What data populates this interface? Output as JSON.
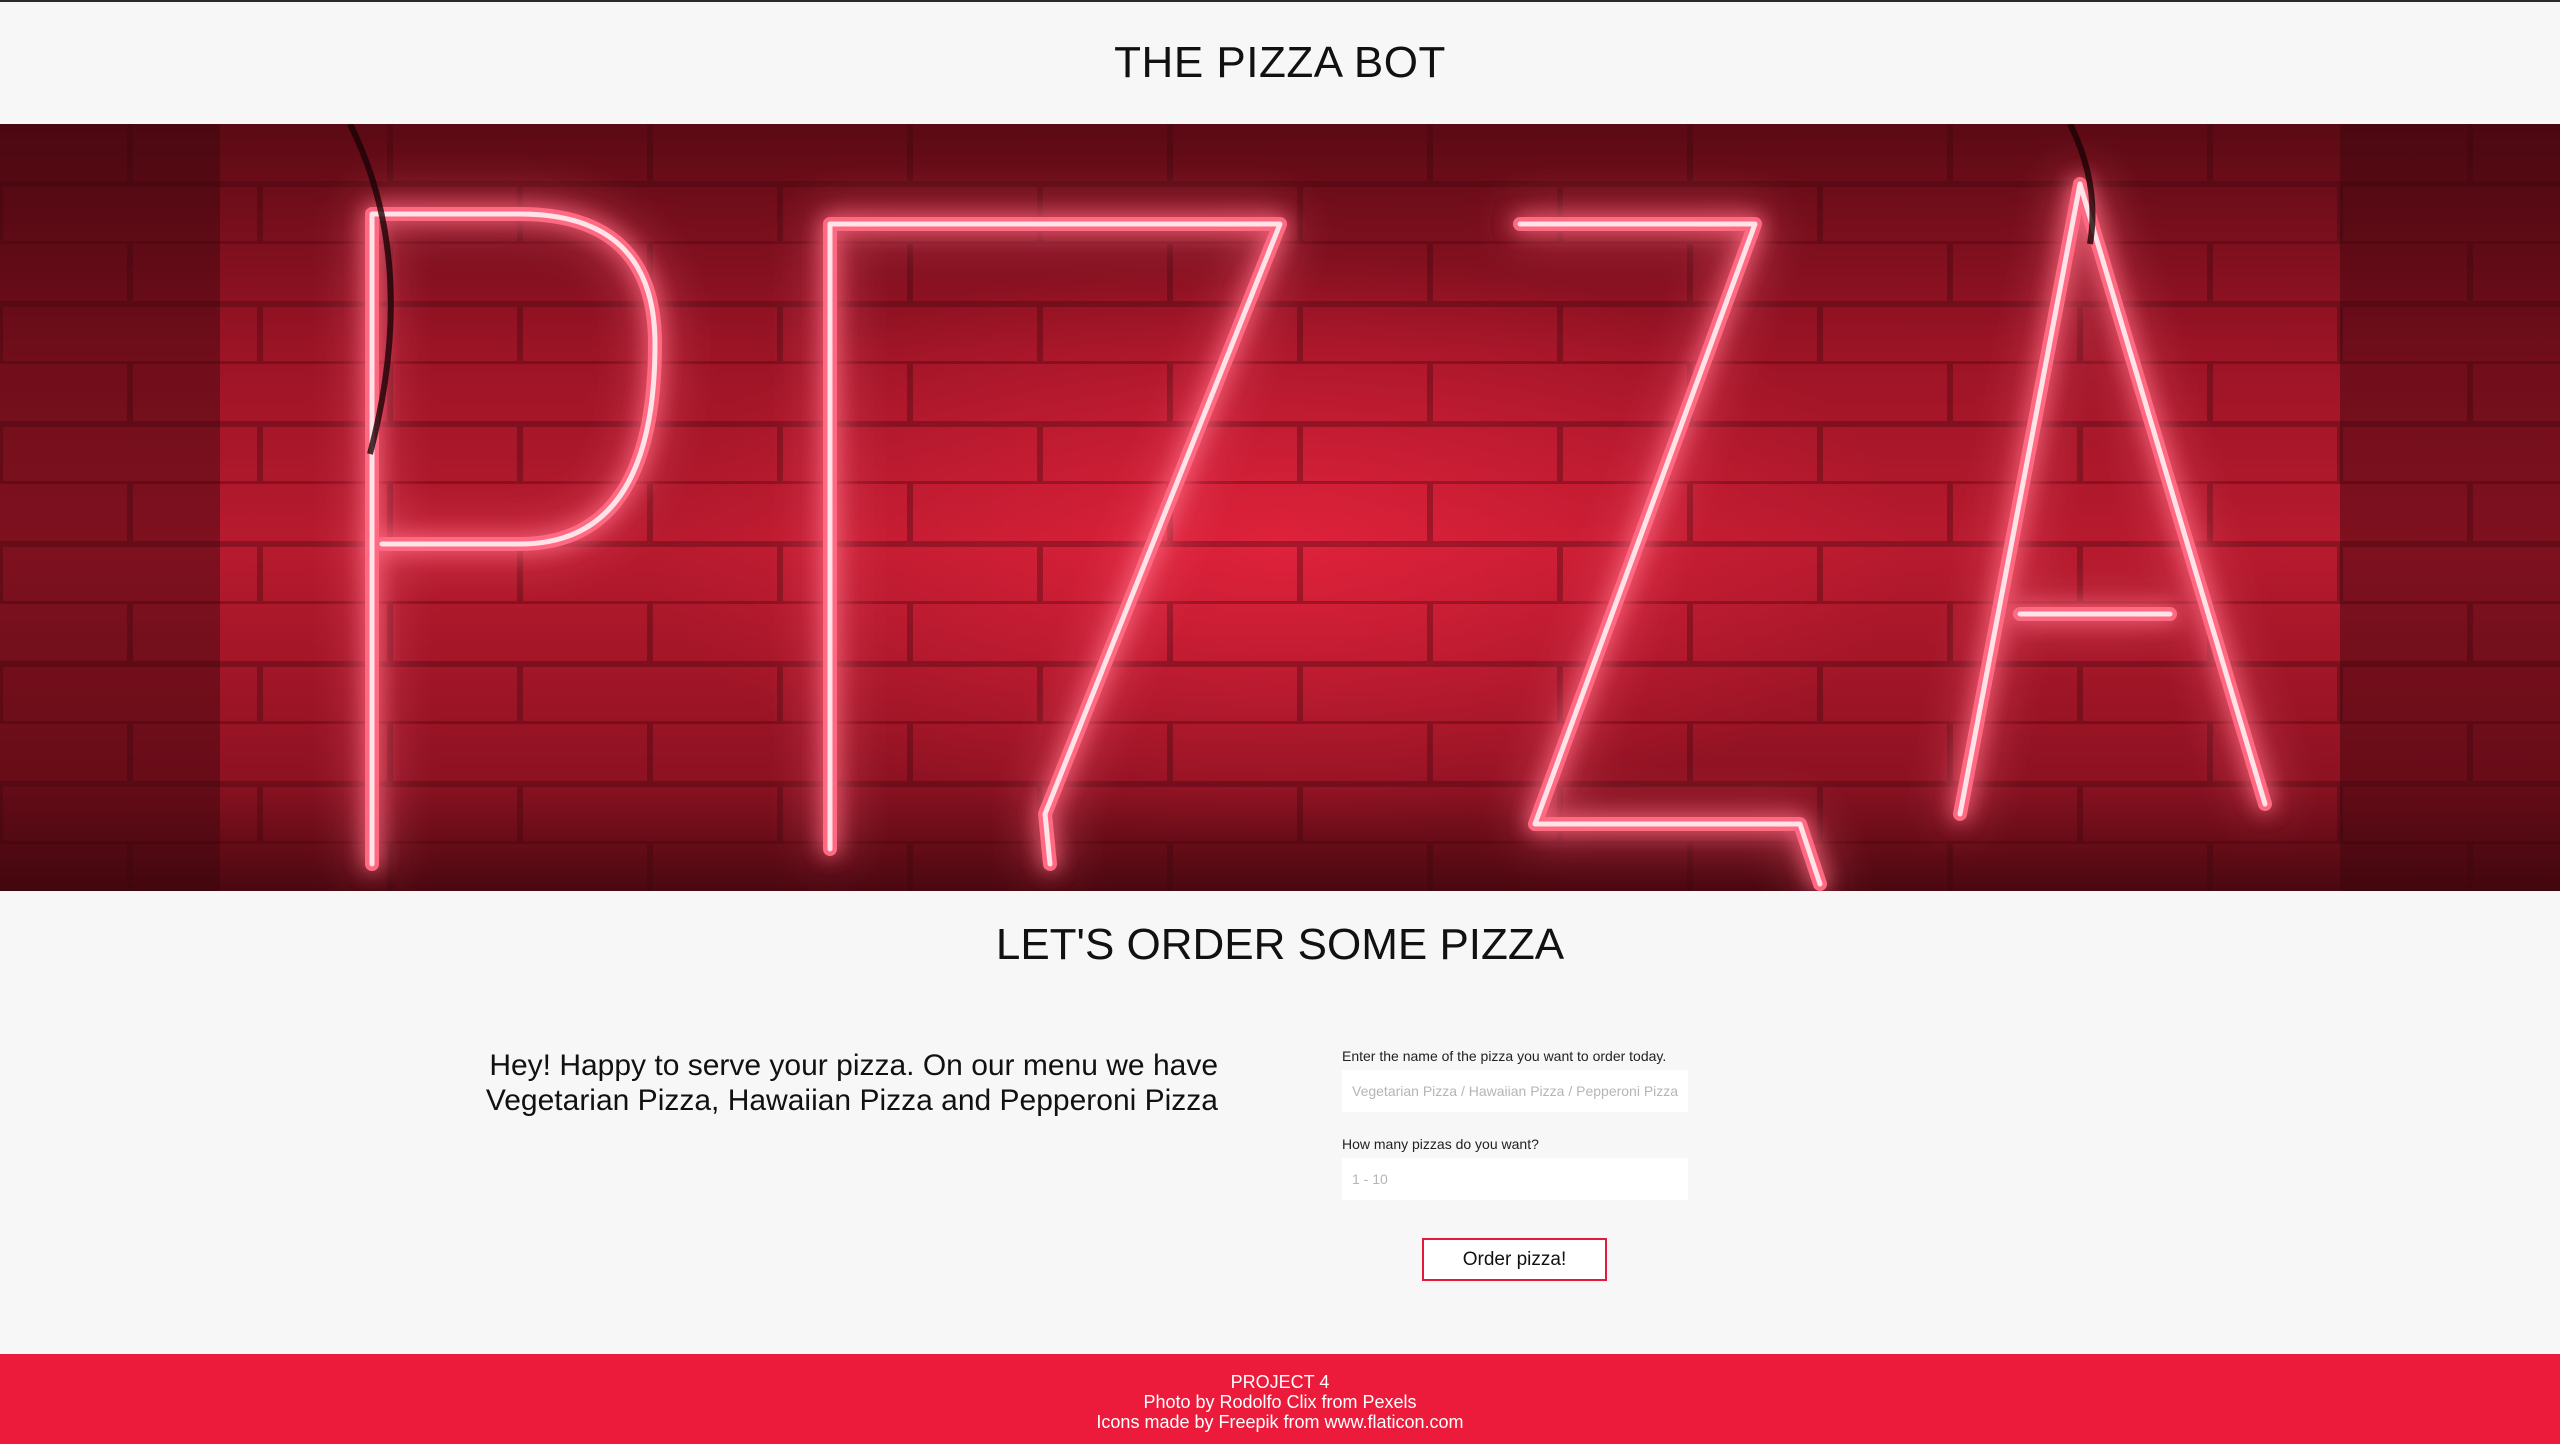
{
  "header": {
    "title": "THE PIZZA BOT"
  },
  "hero": {
    "image_alt": "Red neon PIZZA sign on brick wall",
    "sign_text": "PIZZA",
    "accent_color": "#ff2a4a"
  },
  "main": {
    "section_title": "LET'S ORDER SOME PIZZA",
    "intro_text": "Hey! Happy to serve your pizza. On our menu we have Vegetarian Pizza, Hawaiian Pizza and Pepperoni Pizza"
  },
  "form": {
    "pizza_label": "Enter the name of the pizza you want to order today.",
    "pizza_placeholder": "Vegetarian Pizza / Hawaiian Pizza / Pepperoni Pizza",
    "pizza_value": "",
    "quantity_label": "How many pizzas do you want?",
    "quantity_placeholder": "1 - 10",
    "quantity_value": "",
    "submit_label": "Order pizza!"
  },
  "footer": {
    "line1": "PROJECT 4",
    "line2": "Photo by Rodolfo Clix from Pexels",
    "line3": "Icons made by Freepik from www.flaticon.com",
    "background_color": "#ec1a3b"
  },
  "colors": {
    "page_bg": "#f7f7f7",
    "button_border": "#e31a3c"
  }
}
